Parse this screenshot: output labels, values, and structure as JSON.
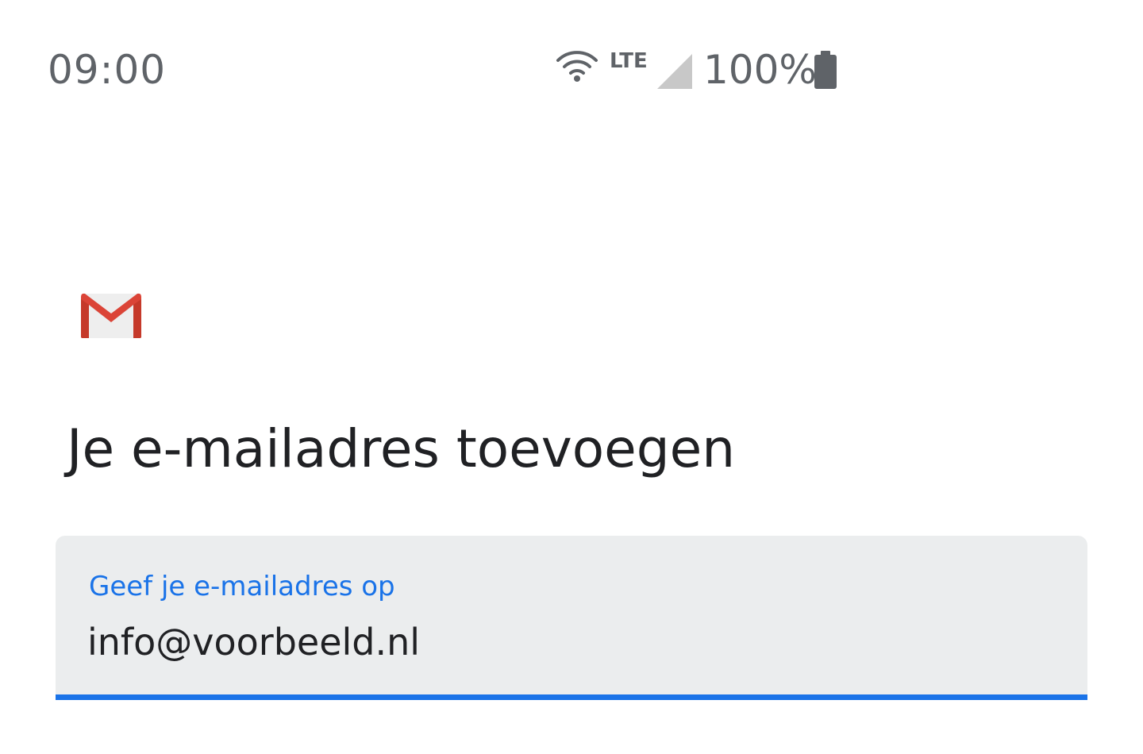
{
  "status_bar": {
    "time": "09:00",
    "network_type": "LTE",
    "battery_percent": "100%",
    "icons": [
      "wifi-icon",
      "signal-icon",
      "battery-icon"
    ],
    "icon_color": "#5f6368"
  },
  "app": {
    "logo_icon": "gmail-logo-icon",
    "logo_colors": {
      "red": "#db4437",
      "dark_red": "#b23121",
      "envelope": "#eeeeee"
    }
  },
  "main": {
    "title": "Je e-mailadres toevoegen",
    "email_field": {
      "label": "Geef je e-mailadres op",
      "value": "info@voorbeeld.nl",
      "accent_color": "#1a73e8",
      "background_color": "#ebedee"
    }
  }
}
